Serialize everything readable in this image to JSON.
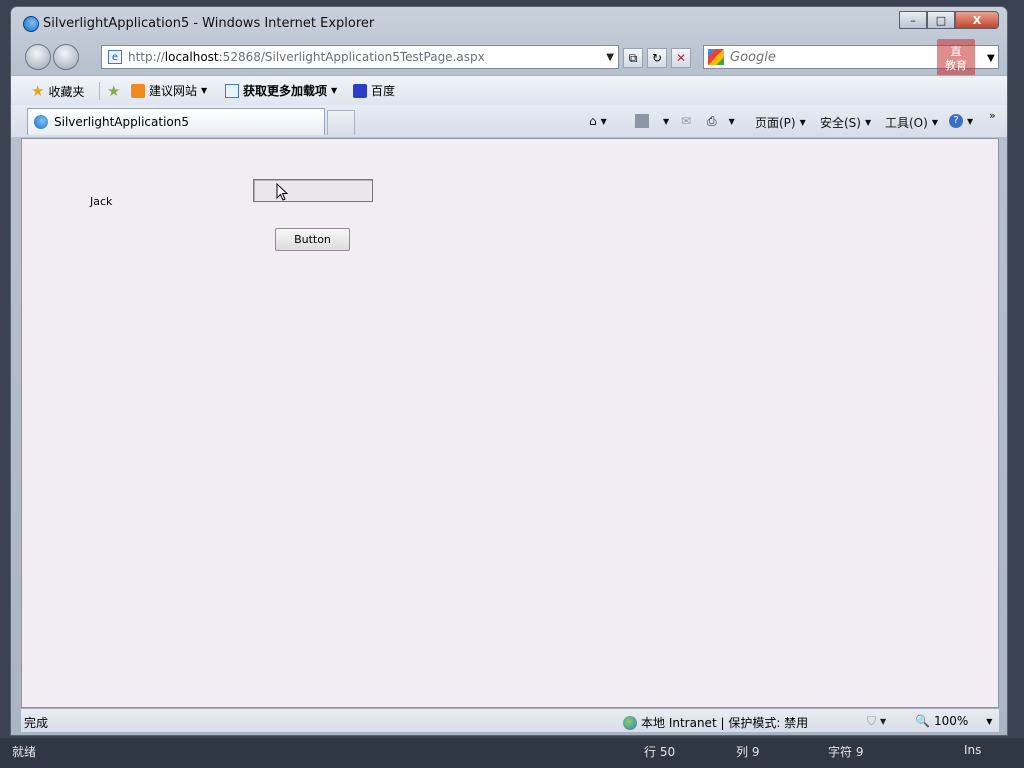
{
  "window": {
    "title": "SilverlightApplication5 - Windows Internet Explorer",
    "caption_buttons": {
      "minimize": "–",
      "maximize": "□",
      "close": "X"
    }
  },
  "navigation": {
    "address_prefix": "http://",
    "address_host": "localhost",
    "address_rest": ":52868/SilverlightApplication5TestPage.aspx",
    "search_placeholder": "Google"
  },
  "favorites_bar": {
    "favorites_label": "收藏夹",
    "suggested_sites_label": "建议网站",
    "get_addons_label": "获取更多加载项",
    "baidu_label": "百度"
  },
  "tabs": [
    {
      "label": "SilverlightApplication5"
    }
  ],
  "command_bar": {
    "page_label": "页面(P)",
    "safety_label": "安全(S)",
    "tools_label": "工具(O)",
    "overflow": "»"
  },
  "page": {
    "label_text": "Jack",
    "textbox_value": "",
    "button_label": "Button"
  },
  "status_bar": {
    "status_text": "完成",
    "zone_text": "本地 Intranet | 保护模式: 禁用",
    "zoom": "100%"
  },
  "outer_status": {
    "ready": "就绪",
    "line": "行 50",
    "column": "列 9",
    "char": "字符 9",
    "mode": "Ins"
  },
  "watermark": {
    "line1": "直",
    "line2": "教育"
  }
}
